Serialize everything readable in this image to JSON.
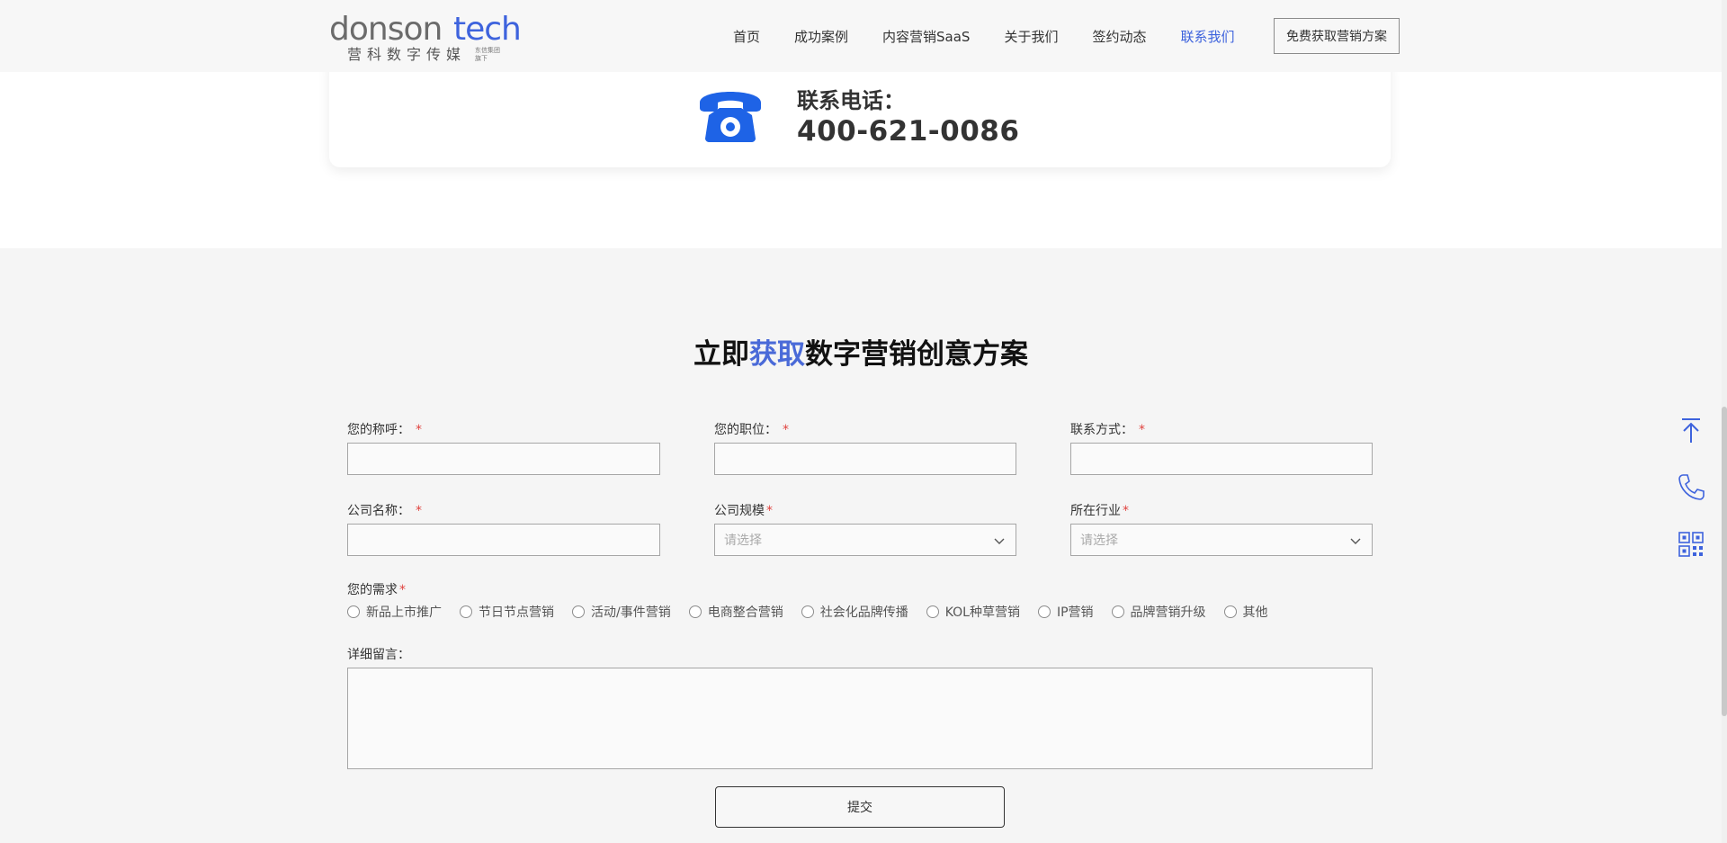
{
  "header": {
    "logo": {
      "wordmark": "donsontech",
      "subtitle": "营科数字传媒",
      "tagline": "东信集团旗下"
    },
    "nav": [
      {
        "label": "首页",
        "active": false
      },
      {
        "label": "成功案例",
        "active": false
      },
      {
        "label": "内容营销SaaS",
        "active": false
      },
      {
        "label": "关于我们",
        "active": false
      },
      {
        "label": "签约动态",
        "active": false
      },
      {
        "label": "联系我们",
        "active": true
      }
    ],
    "cta_label": "免费获取营销方案"
  },
  "phone_card": {
    "label": "联系电话：",
    "number": "400-621-0086"
  },
  "form": {
    "title_prefix": "立即",
    "title_highlight": "获取",
    "title_suffix": "数字营销创意方案",
    "required_mark": "*",
    "fields": {
      "name": {
        "label": "您的称呼：",
        "value": ""
      },
      "position": {
        "label": "您的职位：",
        "value": ""
      },
      "contact": {
        "label": "联系方式：",
        "value": ""
      },
      "company": {
        "label": "公司名称：",
        "value": ""
      },
      "scale": {
        "label": "公司规模",
        "placeholder": "请选择"
      },
      "industry": {
        "label": "所在行业",
        "placeholder": "请选择"
      }
    },
    "needs_label": "您的需求",
    "needs_options": [
      "新品上市推广",
      "节日节点营销",
      "活动/事件营销",
      "电商整合营销",
      "社会化品牌传播",
      "KOL种草营销",
      "IP营销",
      "品牌营销升级",
      "其他"
    ],
    "message_label": "详细留言：",
    "submit_label": "提交"
  },
  "side_icons": [
    "arrow-up-icon",
    "phone-icon",
    "qrcode-icon"
  ],
  "colors": {
    "accent": "#3e63dd",
    "phone_icon": "#1e63e6",
    "required": "#e0433f"
  }
}
